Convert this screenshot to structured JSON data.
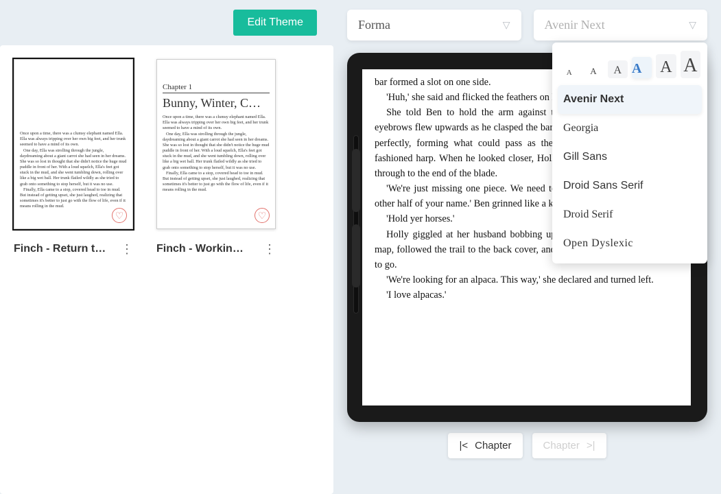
{
  "toolbar": {
    "edit_theme_label": "Edit Theme"
  },
  "device_selector": {
    "selected": "Forma"
  },
  "font_selector": {
    "selected": "Avenir Next"
  },
  "font_sizes": [
    "A",
    "A",
    "A",
    "A",
    "A",
    "A"
  ],
  "font_size_px": [
    11,
    13,
    16,
    20,
    24,
    28
  ],
  "font_size_selected_index": 3,
  "font_options": [
    {
      "label": "Avenir Next",
      "css": "sel"
    },
    {
      "label": "Georgia",
      "css": "font-georgia"
    },
    {
      "label": "Gill Sans",
      "css": "font-gill"
    },
    {
      "label": "Droid Sans Serif",
      "css": "font-droidss"
    },
    {
      "label": "Droid Serif",
      "css": "font-droidserif"
    },
    {
      "label": "Open Dyslexic",
      "css": "font-dys"
    }
  ],
  "themes": [
    {
      "label": "Finch - Return t…",
      "selected": true,
      "has_header": false
    },
    {
      "label": "Finch - Workin…",
      "selected": false,
      "has_header": true
    }
  ],
  "thumb_header": {
    "chapter": "Chapter 1",
    "title": "Bunny, Winter, C…"
  },
  "thumb_body_text": "Once upon a time, there was a clumsy elephant named Ella. Ella was always tripping over her own big feet, and her trunk seemed to have a mind of its own.\nOne day, Ella was strolling through the jungle, daydreaming about a giant carrot she had seen in her dreams. She was so lost in thought that she didn't notice the huge mud puddle in front of her. With a loud squelch, Ella's feet got stuck in the mud, and she went tumbling down, rolling over like a big wet ball. Her trunk flailed wildly as she tried to grab onto something to stop herself, but it was no use.\nFinally, Ella came to a stop, covered head to toe in mud. But instead of getting upset, she just laughed, realizing that sometimes it's better to just go with the flow of life, even if it means rolling in the mud.",
  "reader_text": [
    "bar formed a slot on one side.",
    "'Huh,' she said and flicked the feathers on her wings.",
    "She told Ben to hold the arm against the keel. Doubtful at first, his eyebrows flew upwards as he clasped the bar around the keel's front. It fitted perfectly, forming what could pass as the curved bow of a small old-fashioned harp. When he looked closer, Holly pointed out the slot ran right through to the end of the blade.",
    "'We're just missing one piece. We need to find it. And we can learn the other half of your name.' Ben grinned like a kid. 'Which way? Which way?'",
    "'Hold yer horses.'",
    "Holly giggled at her husband bobbing up and down. She looked at the map, followed the trail to the back cover, and found that they didn't have far to go.",
    "'We're looking for an alpaca. This way,' she declared and turned left.",
    "'I love alpacas.'"
  ],
  "pager": {
    "prev": "Chapter",
    "next": "Chapter"
  }
}
